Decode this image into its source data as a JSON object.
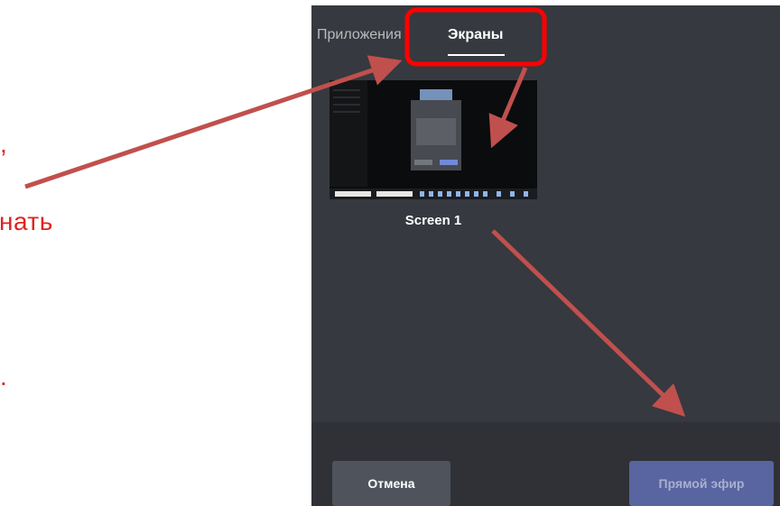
{
  "slide": {
    "fragment_1": ",",
    "fragment_2": "нать",
    "fragment_3": "."
  },
  "modal": {
    "tabs": [
      {
        "label": "Приложения",
        "active": false
      },
      {
        "label": "Экраны",
        "active": true
      }
    ],
    "screens": [
      {
        "label": "Screen 1"
      }
    ],
    "buttons": {
      "cancel_label": "Отмена",
      "go_live_label": "Прямой эфир"
    }
  },
  "colors": {
    "modal_background": "#36393f",
    "footer_background": "#2f3136",
    "annotation_red": "#c0504d",
    "highlight_red": "#ff0000",
    "slide_text_red": "#e0231f"
  }
}
